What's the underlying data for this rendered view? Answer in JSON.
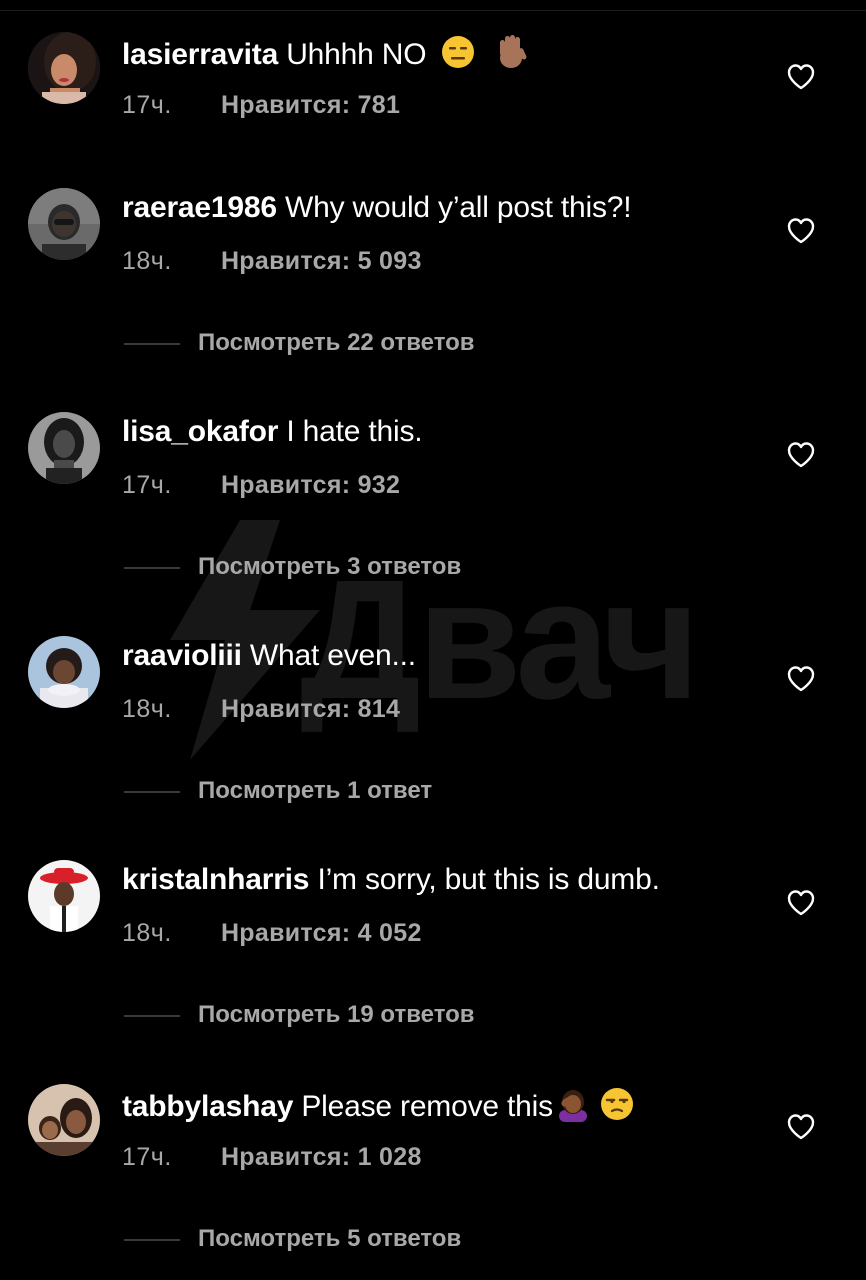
{
  "watermark": {
    "text": "Двач"
  },
  "colors": {
    "background": "#000000",
    "text_primary": "#ffffff",
    "text_secondary": "#a8a8a8",
    "heart_outline": "#ffffff"
  },
  "comments": [
    {
      "username": "lasierravita",
      "text": "Uhhhh NO",
      "emojis": [
        "expressionless-face",
        "raised-hand"
      ],
      "time": "17ч.",
      "likes_label": "Нравится: 781",
      "replies_label": ""
    },
    {
      "username": "raerae1986",
      "text": "Why would y’all post this?!",
      "emojis": [],
      "time": "18ч.",
      "likes_label": "Нравится: 5 093",
      "replies_label": "Посмотреть 22 ответов"
    },
    {
      "username": "lisa_okafor",
      "text": "I hate this.",
      "emojis": [],
      "time": "17ч.",
      "likes_label": "Нравится: 932",
      "replies_label": "Посмотреть 3 ответов"
    },
    {
      "username": "raavioliii",
      "text": "What even...",
      "emojis": [],
      "time": "18ч.",
      "likes_label": "Нравится: 814",
      "replies_label": "Посмотреть 1 ответ"
    },
    {
      "username": "kristalnharris",
      "text": "I’m sorry, but this is dumb.",
      "emojis": [],
      "time": "18ч.",
      "likes_label": "Нравится: 4 052",
      "replies_label": "Посмотреть 19 ответов"
    },
    {
      "username": "tabbylashay",
      "text": "Please remove this",
      "emojis": [
        "person-facepalming",
        "unamused-face"
      ],
      "time": "17ч.",
      "likes_label": "Нравится: 1 028",
      "replies_label": "Посмотреть 5 ответов"
    }
  ]
}
